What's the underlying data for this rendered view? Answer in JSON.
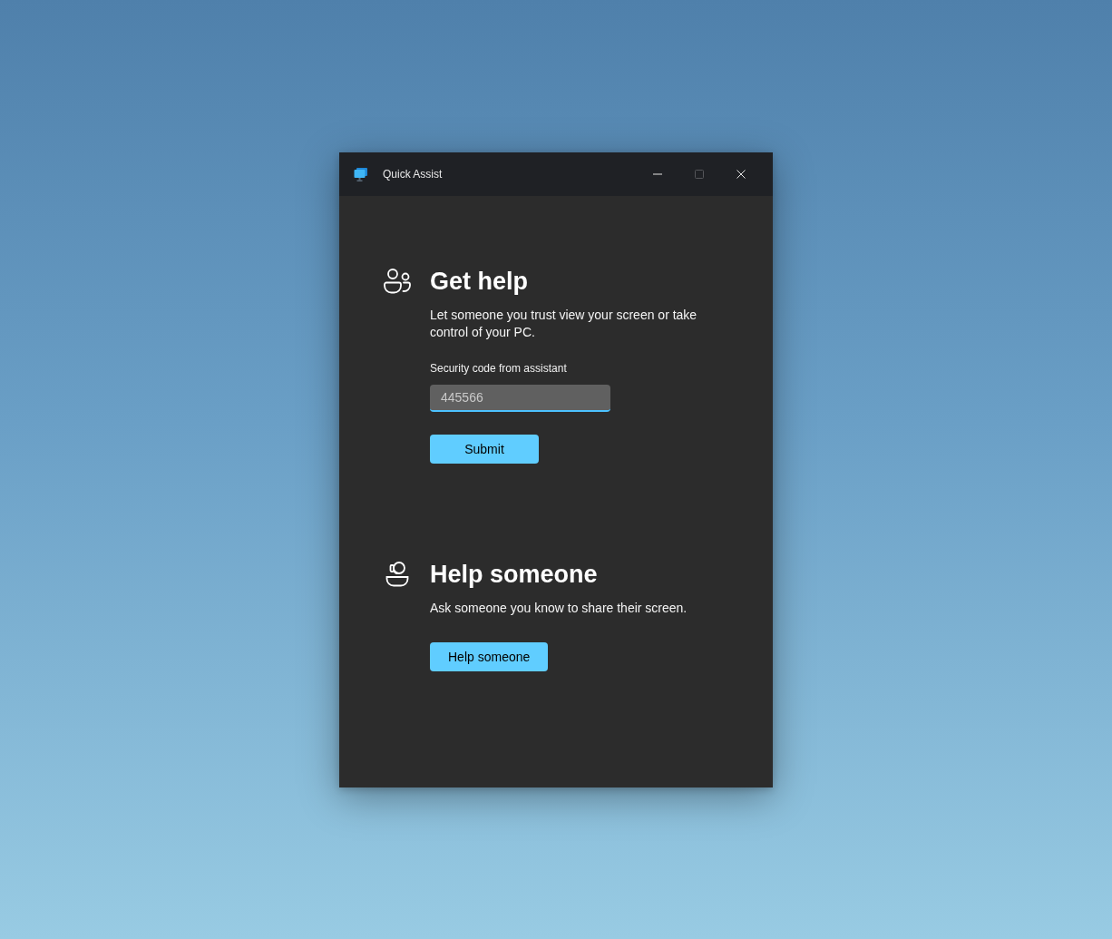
{
  "window": {
    "title": "Quick Assist",
    "controls": [
      {
        "kind": "minimize",
        "disabled": false
      },
      {
        "kind": "maximize",
        "disabled": true
      },
      {
        "kind": "close",
        "disabled": false
      }
    ]
  },
  "get_help": {
    "heading": "Get help",
    "description": "Let someone you trust view your screen or take control of your PC.",
    "code_field": {
      "label": "Security code from assistant",
      "value": "445566",
      "focused": true
    },
    "submit_button": "Submit"
  },
  "help_someone": {
    "heading": "Help someone",
    "description": "Ask someone you know to share their screen.",
    "button": "Help someone"
  }
}
